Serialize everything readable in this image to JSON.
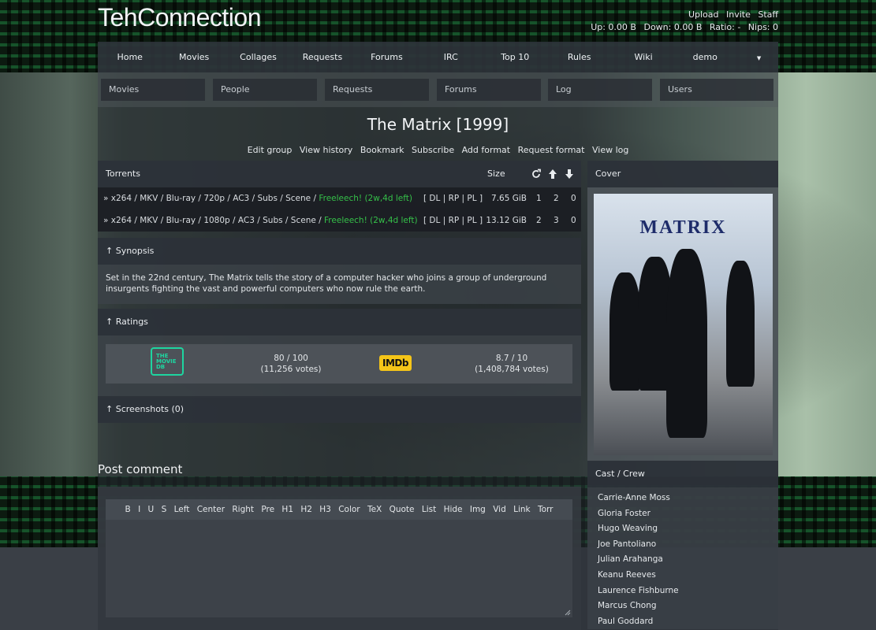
{
  "site": {
    "logo": "TehConnection"
  },
  "userbar": {
    "links": [
      "Upload",
      "Invite",
      "Staff"
    ],
    "stats": [
      "Up: 0.00 B",
      "Down: 0.00 B",
      "Ratio: -",
      "Nips: 0"
    ]
  },
  "nav": {
    "items": [
      "Home",
      "Movies",
      "Collages",
      "Requests",
      "Forums",
      "IRC",
      "Top 10",
      "Rules",
      "Wiki",
      "demo"
    ]
  },
  "search": {
    "fields": [
      "Movies",
      "People",
      "Requests",
      "Forums",
      "Log",
      "Users"
    ]
  },
  "movie": {
    "title": "The Matrix [1999]",
    "actions": [
      "Edit group",
      "View history",
      "Bookmark",
      "Subscribe",
      "Add format",
      "Request format",
      "View log"
    ]
  },
  "torrents": {
    "header": "Torrents",
    "size_label": "Size",
    "rows": [
      {
        "prefix": "» x264 / MKV / Blu-ray / 720p / AC3 / Subs / Scene / ",
        "freeleech": "Freeleech! (2w,4d left)",
        "links": "[ DL | RP | PL ]",
        "size": "7.65 GiB",
        "snatched": "1",
        "seeders": "2",
        "leechers": "0"
      },
      {
        "prefix": "» x264 / MKV / Blu-ray / 1080p / AC3 / Subs / Scene / ",
        "freeleech": "Freeleech! (2w,4d left)",
        "links": "[ DL | RP | PL ]",
        "size": "13.12 GiB",
        "snatched": "2",
        "seeders": "3",
        "leechers": "0"
      }
    ]
  },
  "synopsis": {
    "header": "↑ Synopsis",
    "text": "Set in the 22nd century, The Matrix tells the story of a computer hacker who joins a group of underground insurgents fighting the vast and powerful computers who now rule the earth."
  },
  "ratings": {
    "header": "↑ Ratings",
    "tmdb": {
      "logo": "THE MOVIE DB",
      "score": "80 / 100",
      "votes": "(11,256 votes)"
    },
    "imdb": {
      "logo": "IMDb",
      "score": "8.7 / 10",
      "votes": "(1,408,784 votes)"
    }
  },
  "screenshots": {
    "header": "↑  Screenshots (0)"
  },
  "cover": {
    "header": "Cover",
    "poster_title": "MATRIX"
  },
  "cast": {
    "header": "Cast / Crew",
    "members": [
      "Carrie-Anne Moss",
      "Gloria Foster",
      "Hugo Weaving",
      "Joe Pantoliano",
      "Julian Arahanga",
      "Keanu Reeves",
      "Laurence Fishburne",
      "Marcus Chong",
      "Paul Goddard"
    ]
  },
  "comment": {
    "title": "Post comment",
    "toolbar": [
      "B",
      "I",
      "U",
      "S",
      "Left",
      "Center",
      "Right",
      "Pre",
      "H1",
      "H2",
      "H3",
      "Color",
      "TeX",
      "Quote",
      "List",
      "Hide",
      "Img",
      "Vid",
      "Link",
      "Torr"
    ]
  },
  "colors": {
    "accent_green": "#35c049",
    "tmdb_green": "#1ed5a0",
    "imdb_yellow": "#f5c518"
  }
}
